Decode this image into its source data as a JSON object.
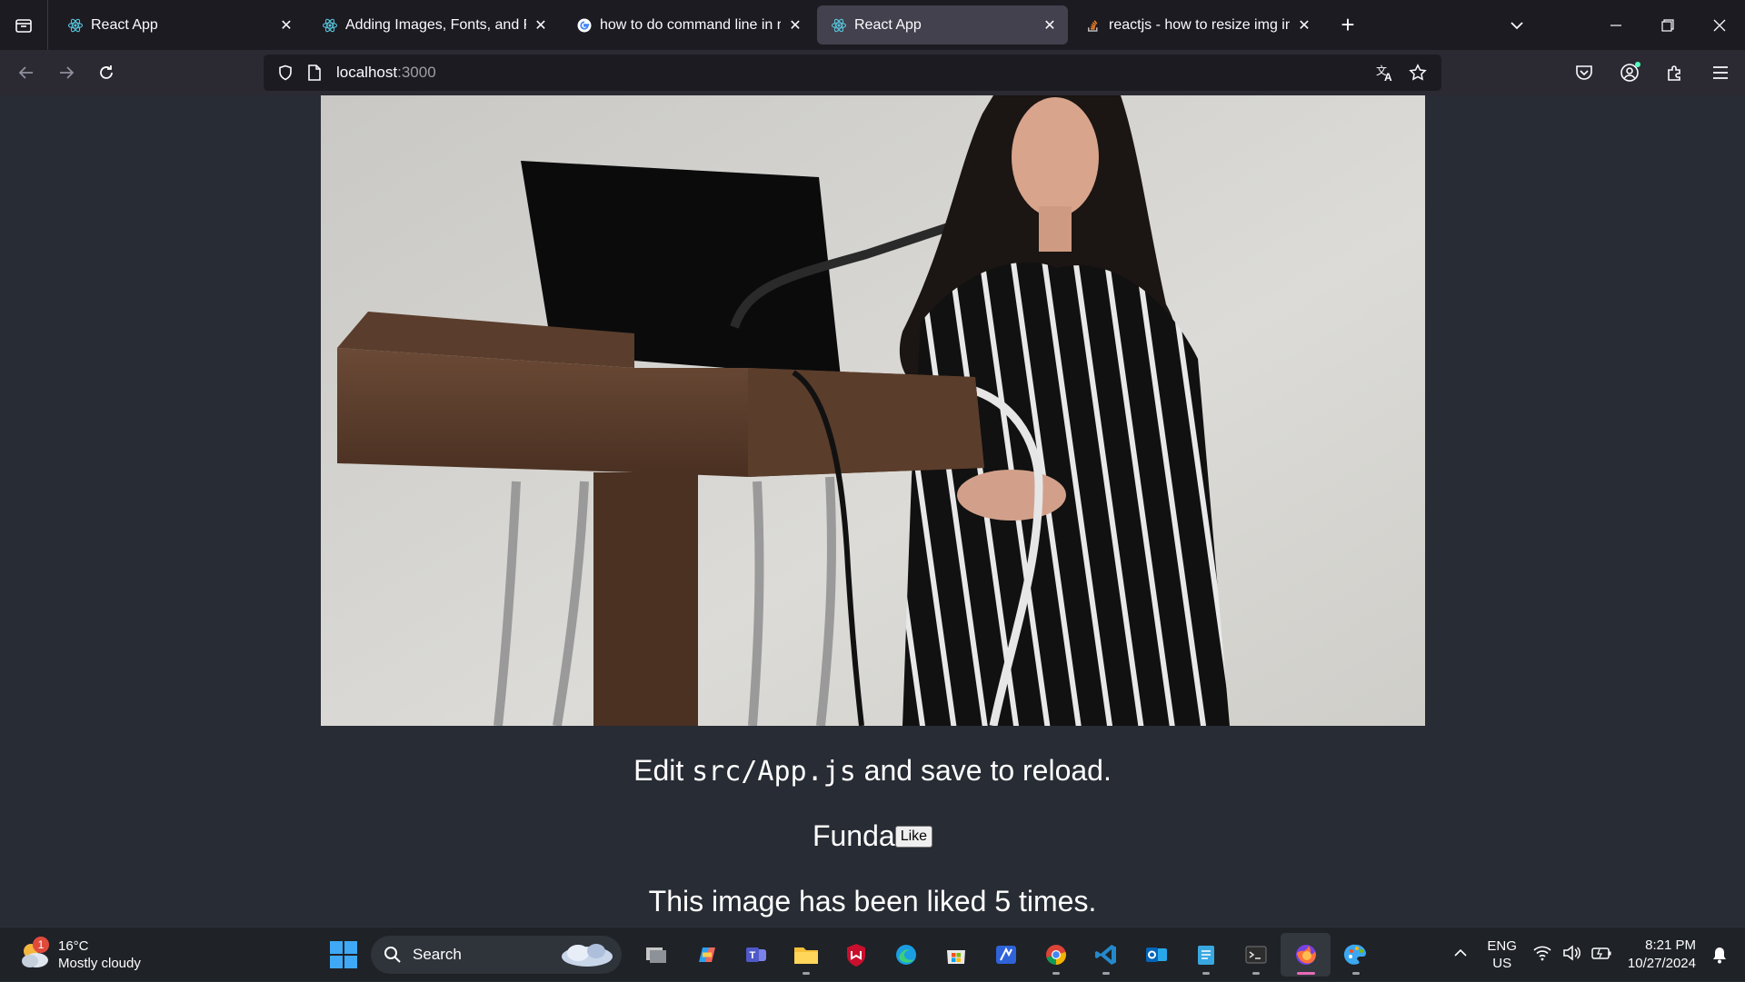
{
  "browser": {
    "tabs": [
      {
        "title": "React App",
        "favicon": "react-icon",
        "active": false
      },
      {
        "title": "Adding Images, Fonts, and Files",
        "favicon": "react-icon",
        "active": false
      },
      {
        "title": "how to do command line in rea",
        "favicon": "google-icon",
        "active": false
      },
      {
        "title": "React App",
        "favicon": "react-icon",
        "active": true
      },
      {
        "title": "reactjs - how to resize img in Re",
        "favicon": "stackoverflow-icon",
        "active": false
      }
    ],
    "new_tab_label": "+",
    "url_host": "localhost",
    "url_port": ":3000"
  },
  "page": {
    "edit_prefix": "Edit ",
    "edit_code": "src/App.js",
    "edit_suffix": " and save to reload.",
    "name": "Funda",
    "like_label": "Like",
    "liked_text": "This image has been liked 5 times.",
    "photo_icon": "speaker-at-podium-photo"
  },
  "taskbar": {
    "weather_temp": "16°C",
    "weather_desc": "Mostly cloudy",
    "weather_badge": "1",
    "search_placeholder": "Search",
    "apps": [
      {
        "name": "task-view-icon",
        "running": false
      },
      {
        "name": "copilot-icon",
        "running": false
      },
      {
        "name": "teams-icon",
        "running": false
      },
      {
        "name": "file-explorer-icon",
        "running": true
      },
      {
        "name": "mcafee-icon",
        "running": false
      },
      {
        "name": "edge-icon",
        "running": false
      },
      {
        "name": "microsoft-store-icon",
        "running": false
      },
      {
        "name": "powerautomate-icon",
        "running": false
      },
      {
        "name": "chrome-icon",
        "running": true
      },
      {
        "name": "vscode-icon",
        "running": true
      },
      {
        "name": "outlook-icon",
        "running": false
      },
      {
        "name": "notepad-icon",
        "running": true
      },
      {
        "name": "terminal-icon",
        "running": true
      },
      {
        "name": "firefox-icon",
        "running": true,
        "active": true
      },
      {
        "name": "paint-icon",
        "running": true
      }
    ],
    "lang_line1": "ENG",
    "lang_line2": "US",
    "time": "8:21 PM",
    "date": "10/27/2024"
  },
  "colors": {
    "page_bg": "#282c34",
    "tabstrip_bg": "#1c1b22",
    "navbar_bg": "#2b2a33",
    "active_tab_bg": "#42414d",
    "taskbar_bg": "#1f2227",
    "firefox_indicator": "#e76ab8"
  }
}
